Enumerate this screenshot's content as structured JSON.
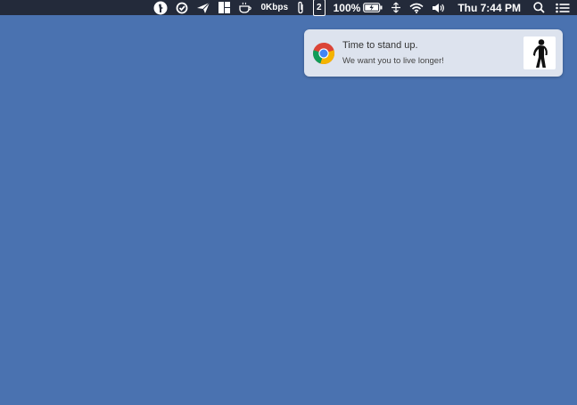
{
  "menubar": {
    "bandwidth": "0Kbps",
    "desktop_number": "2",
    "battery_percent": "100%",
    "clock": "Thu 7:44 PM"
  },
  "notification": {
    "title": "Time to stand up.",
    "body": "We want you to live longer!"
  },
  "icons": {
    "app_icon": "chrome-icon",
    "image": "stretching-person-icon"
  },
  "colors": {
    "desktop": "#4a72b0",
    "menubar": "#232a3a",
    "notification_bg": "#dde3ee"
  }
}
